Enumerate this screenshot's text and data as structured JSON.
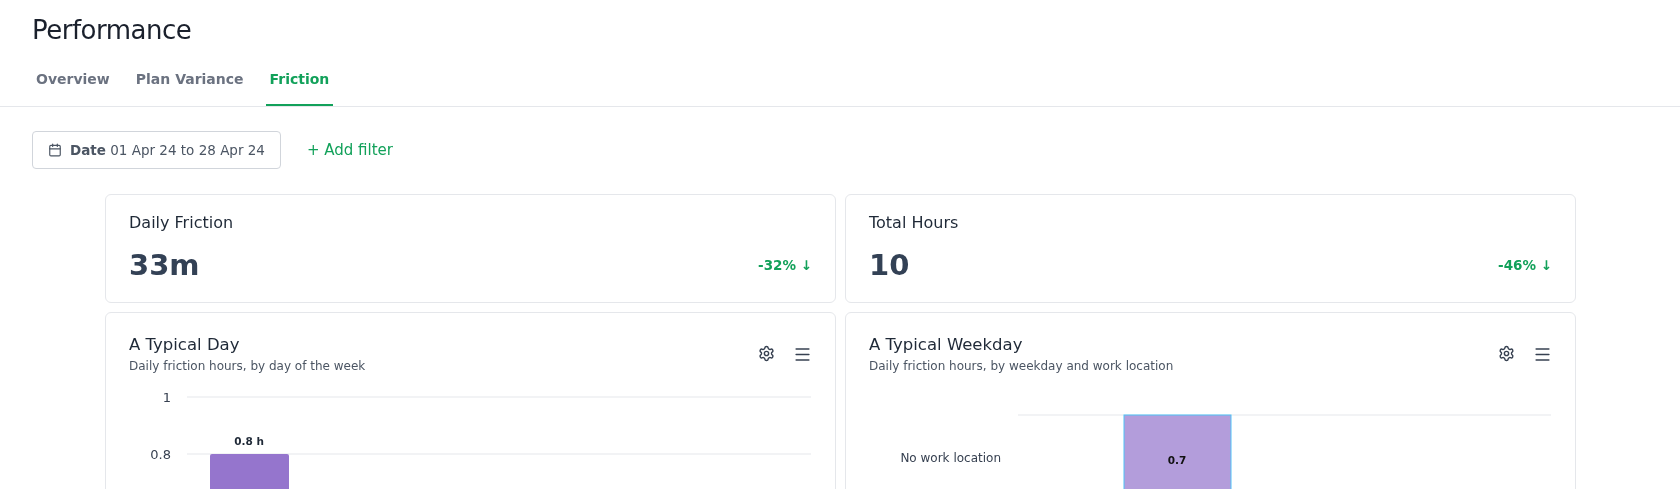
{
  "page": {
    "title": "Performance"
  },
  "tabs": [
    {
      "label": "Overview",
      "selected": false
    },
    {
      "label": "Plan Variance",
      "selected": false
    },
    {
      "label": "Friction",
      "selected": true
    }
  ],
  "filters": {
    "date": {
      "label": "Date",
      "value": "01 Apr 24 to 28 Apr 24"
    },
    "add_filter": "+ Add filter"
  },
  "stats": [
    {
      "title": "Daily Friction",
      "value": "33m",
      "change": "-32% ↓"
    },
    {
      "title": "Total Hours",
      "value": "10",
      "change": "-46% ↓"
    }
  ],
  "charts": [
    {
      "kind": "columns",
      "title": "A Typical Day",
      "subtitle": "Daily friction hours, by day of the week",
      "axis_labels": [
        "1",
        "0.8"
      ],
      "bar_labels": [
        "0.8 h"
      ]
    },
    {
      "kind": "grid",
      "title": "A Typical Weekday",
      "subtitle": "Daily friction hours, by weekday and work location",
      "row_labels": [
        "No work location"
      ],
      "cell_labels": [
        "0.7"
      ]
    }
  ]
}
